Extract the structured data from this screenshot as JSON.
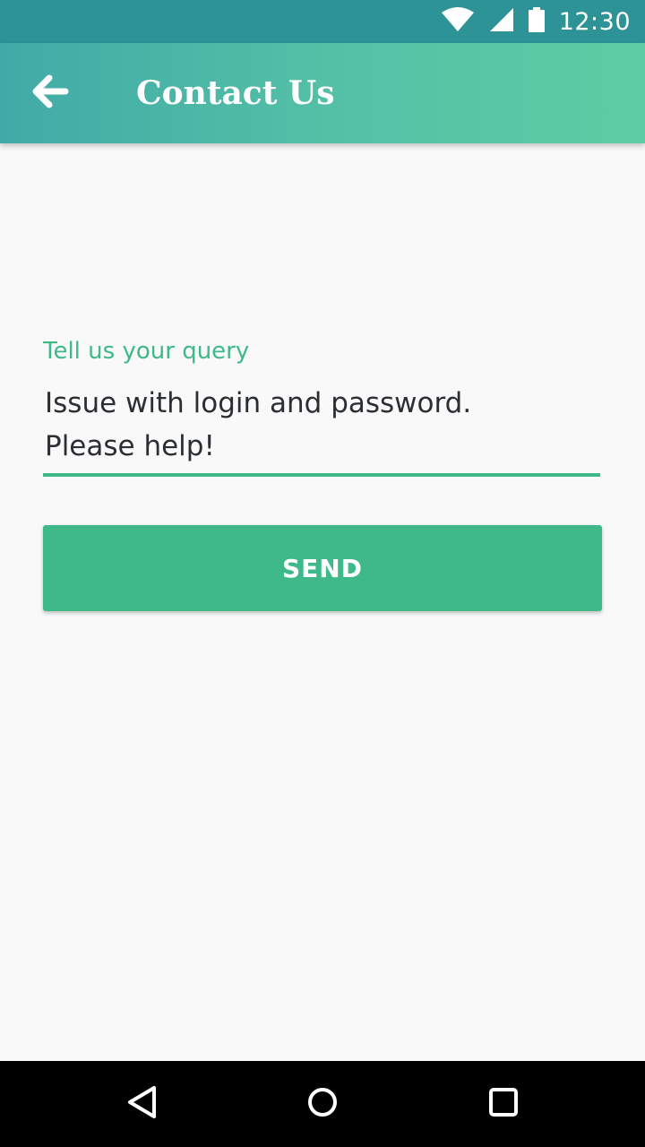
{
  "status_bar": {
    "time": "12:30",
    "icons": [
      "wifi-icon",
      "signal-icon",
      "battery-icon"
    ]
  },
  "app_bar": {
    "back_icon": "arrow-back-icon",
    "title": "Contact Us"
  },
  "form": {
    "query_label": "Tell us your query",
    "query_value": "Issue with login and password.\nPlease help!"
  },
  "send_button": {
    "label": "SEND"
  },
  "nav_bar": {
    "icons": [
      "nav-back-icon",
      "nav-home-icon",
      "nav-recents-icon"
    ]
  },
  "colors": {
    "status_bar": "#2e9397",
    "app_bar_start": "#41aaa7",
    "app_bar_end": "#5dcda3",
    "accent": "#3fb98a",
    "background": "#f9f9f9",
    "text": "#2b2f33"
  }
}
